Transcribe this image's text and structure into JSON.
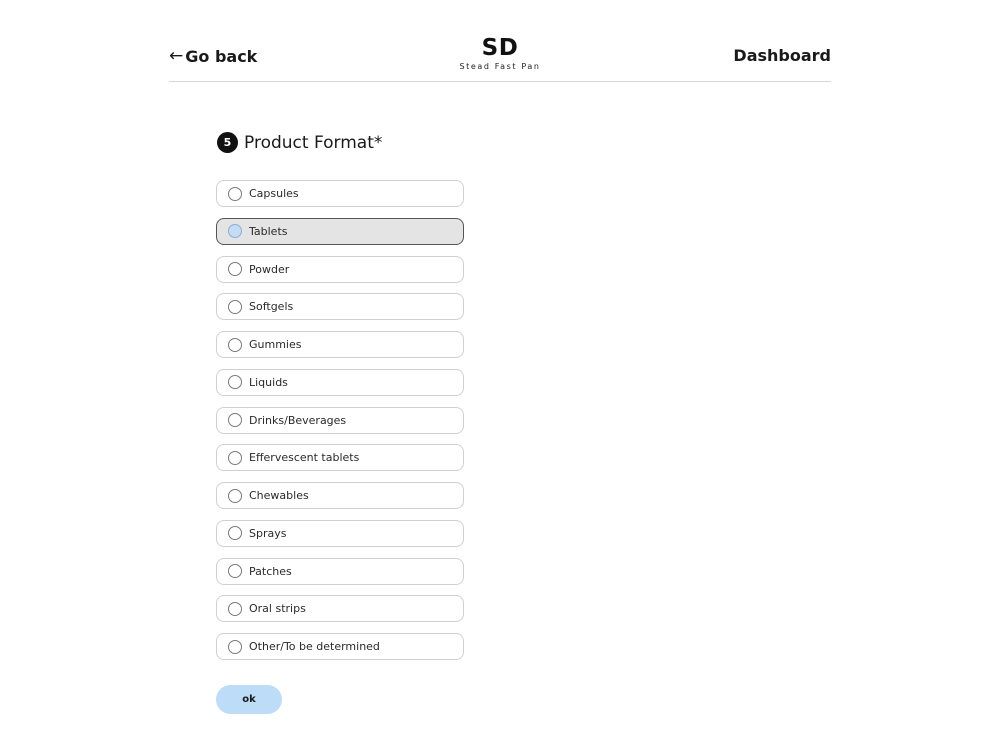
{
  "header": {
    "back_arrow": "←",
    "back_label": "Go back",
    "logo": "SD",
    "tagline": "Stead Fast Pan",
    "dashboard_label": "Dashboard"
  },
  "question": {
    "step": "5",
    "title": "Product Format*"
  },
  "options": [
    {
      "label": "Capsules",
      "selected": false
    },
    {
      "label": "Tablets",
      "selected": true
    },
    {
      "label": "Powder",
      "selected": false
    },
    {
      "label": "Softgels",
      "selected": false
    },
    {
      "label": "Gummies",
      "selected": false
    },
    {
      "label": "Liquids",
      "selected": false
    },
    {
      "label": "Drinks/Beverages",
      "selected": false
    },
    {
      "label": "Effervescent tablets",
      "selected": false
    },
    {
      "label": "Chewables",
      "selected": false
    },
    {
      "label": "Sprays",
      "selected": false
    },
    {
      "label": "Patches",
      "selected": false
    },
    {
      "label": "Oral strips",
      "selected": false
    },
    {
      "label": "Other/To be determined",
      "selected": false
    }
  ],
  "ok_label": "ok",
  "colors": {
    "accent": "#bcdcf7",
    "selected_bg": "#e4e4e4",
    "badge": "#111111"
  }
}
